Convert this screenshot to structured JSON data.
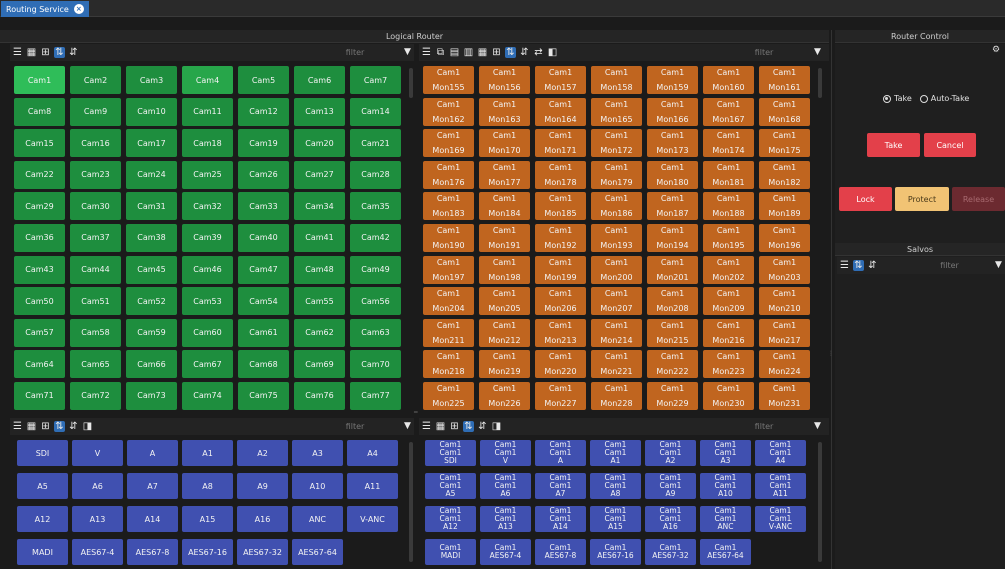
{
  "tab": {
    "label": "Routing Service",
    "close": "×"
  },
  "panels": {
    "logical_router_title": "Logical Router",
    "router_control_title": "Router Control",
    "salvos_title": "Salvos"
  },
  "filters": {
    "video_sources": "filter",
    "video_destinations": "filter",
    "audio_sources": "filter",
    "audio_destinations": "filter",
    "salvos": "filter"
  },
  "video_sources": [
    "Cam1",
    "Cam2",
    "Cam3",
    "Cam4",
    "Cam5",
    "Cam6",
    "Cam7",
    "Cam8",
    "Cam9",
    "Cam10",
    "Cam11",
    "Cam12",
    "Cam13",
    "Cam14",
    "Cam15",
    "Cam16",
    "Cam17",
    "Cam18",
    "Cam19",
    "Cam20",
    "Cam21",
    "Cam22",
    "Cam23",
    "Cam24",
    "Cam25",
    "Cam26",
    "Cam27",
    "Cam28",
    "Cam29",
    "Cam30",
    "Cam31",
    "Cam32",
    "Cam33",
    "Cam34",
    "Cam35",
    "Cam36",
    "Cam37",
    "Cam38",
    "Cam39",
    "Cam40",
    "Cam41",
    "Cam42",
    "Cam43",
    "Cam44",
    "Cam45",
    "Cam46",
    "Cam47",
    "Cam48",
    "Cam49",
    "Cam50",
    "Cam51",
    "Cam52",
    "Cam53",
    "Cam54",
    "Cam55",
    "Cam56",
    "Cam57",
    "Cam58",
    "Cam59",
    "Cam60",
    "Cam61",
    "Cam62",
    "Cam63",
    "Cam64",
    "Cam65",
    "Cam66",
    "Cam67",
    "Cam68",
    "Cam69",
    "Cam70",
    "Cam71",
    "Cam72",
    "Cam73",
    "Cam74",
    "Cam75",
    "Cam76",
    "Cam77"
  ],
  "video_destinations": {
    "source": "Cam1",
    "names": [
      "Mon155",
      "Mon156",
      "Mon157",
      "Mon158",
      "Mon159",
      "Mon160",
      "Mon161",
      "Mon162",
      "Mon163",
      "Mon164",
      "Mon165",
      "Mon166",
      "Mon167",
      "Mon168",
      "Mon169",
      "Mon170",
      "Mon171",
      "Mon172",
      "Mon173",
      "Mon174",
      "Mon175",
      "Mon176",
      "Mon177",
      "Mon178",
      "Mon179",
      "Mon180",
      "Mon181",
      "Mon182",
      "Mon183",
      "Mon184",
      "Mon185",
      "Mon186",
      "Mon187",
      "Mon188",
      "Mon189",
      "Mon190",
      "Mon191",
      "Mon192",
      "Mon193",
      "Mon194",
      "Mon195",
      "Mon196",
      "Mon197",
      "Mon198",
      "Mon199",
      "Mon200",
      "Mon201",
      "Mon202",
      "Mon203",
      "Mon204",
      "Mon205",
      "Mon206",
      "Mon207",
      "Mon208",
      "Mon209",
      "Mon210",
      "Mon211",
      "Mon212",
      "Mon213",
      "Mon214",
      "Mon215",
      "Mon216",
      "Mon217",
      "Mon218",
      "Mon219",
      "Mon220",
      "Mon221",
      "Mon222",
      "Mon223",
      "Mon224",
      "Mon225",
      "Mon226",
      "Mon227",
      "Mon228",
      "Mon229",
      "Mon230",
      "Mon231"
    ]
  },
  "audio_sources": [
    "SDI",
    "V",
    "A",
    "A1",
    "A2",
    "A3",
    "A4",
    "A5",
    "A6",
    "A7",
    "A8",
    "A9",
    "A10",
    "A11",
    "A12",
    "A13",
    "A14",
    "A15",
    "A16",
    "ANC",
    "V-ANC",
    "MADI",
    "AES67-4",
    "AES67-8",
    "AES67-16",
    "AES67-32",
    "AES67-64"
  ],
  "audio_destinations": {
    "line1": "Cam1",
    "line2": "Cam1",
    "names": [
      "SDI",
      "V",
      "A",
      "A1",
      "A2",
      "A3",
      "A4",
      "A5",
      "A6",
      "A7",
      "A8",
      "A9",
      "A10",
      "A11",
      "A12",
      "A13",
      "A14",
      "A15",
      "A16",
      "ANC",
      "V-ANC"
    ],
    "last_row": [
      "MADI",
      "AES67-4",
      "AES67-8",
      "AES67-16",
      "AES67-32",
      "AES67-64"
    ]
  },
  "router_control": {
    "take_mode": "Take",
    "auto_take_mode": "Auto-Take",
    "take": "Take",
    "cancel": "Cancel",
    "lock": "Lock",
    "protect": "Protect",
    "release": "Release"
  },
  "colors": {
    "source_green": "#1e8e3e",
    "selected_green": "#2fbd59",
    "destination_orange": "#c0651f",
    "audio_blue": "#4050b0",
    "tab_blue": "#2f6db5",
    "action_red": "#e3404a",
    "protect_yellow": "#f1c374"
  },
  "icons": [
    "list-view-icon",
    "tile-view-icon",
    "grid-view-icon",
    "sort-asc-icon",
    "sort-desc-icon",
    "filter-funnel-icon",
    "gear-icon",
    "close-icon"
  ]
}
